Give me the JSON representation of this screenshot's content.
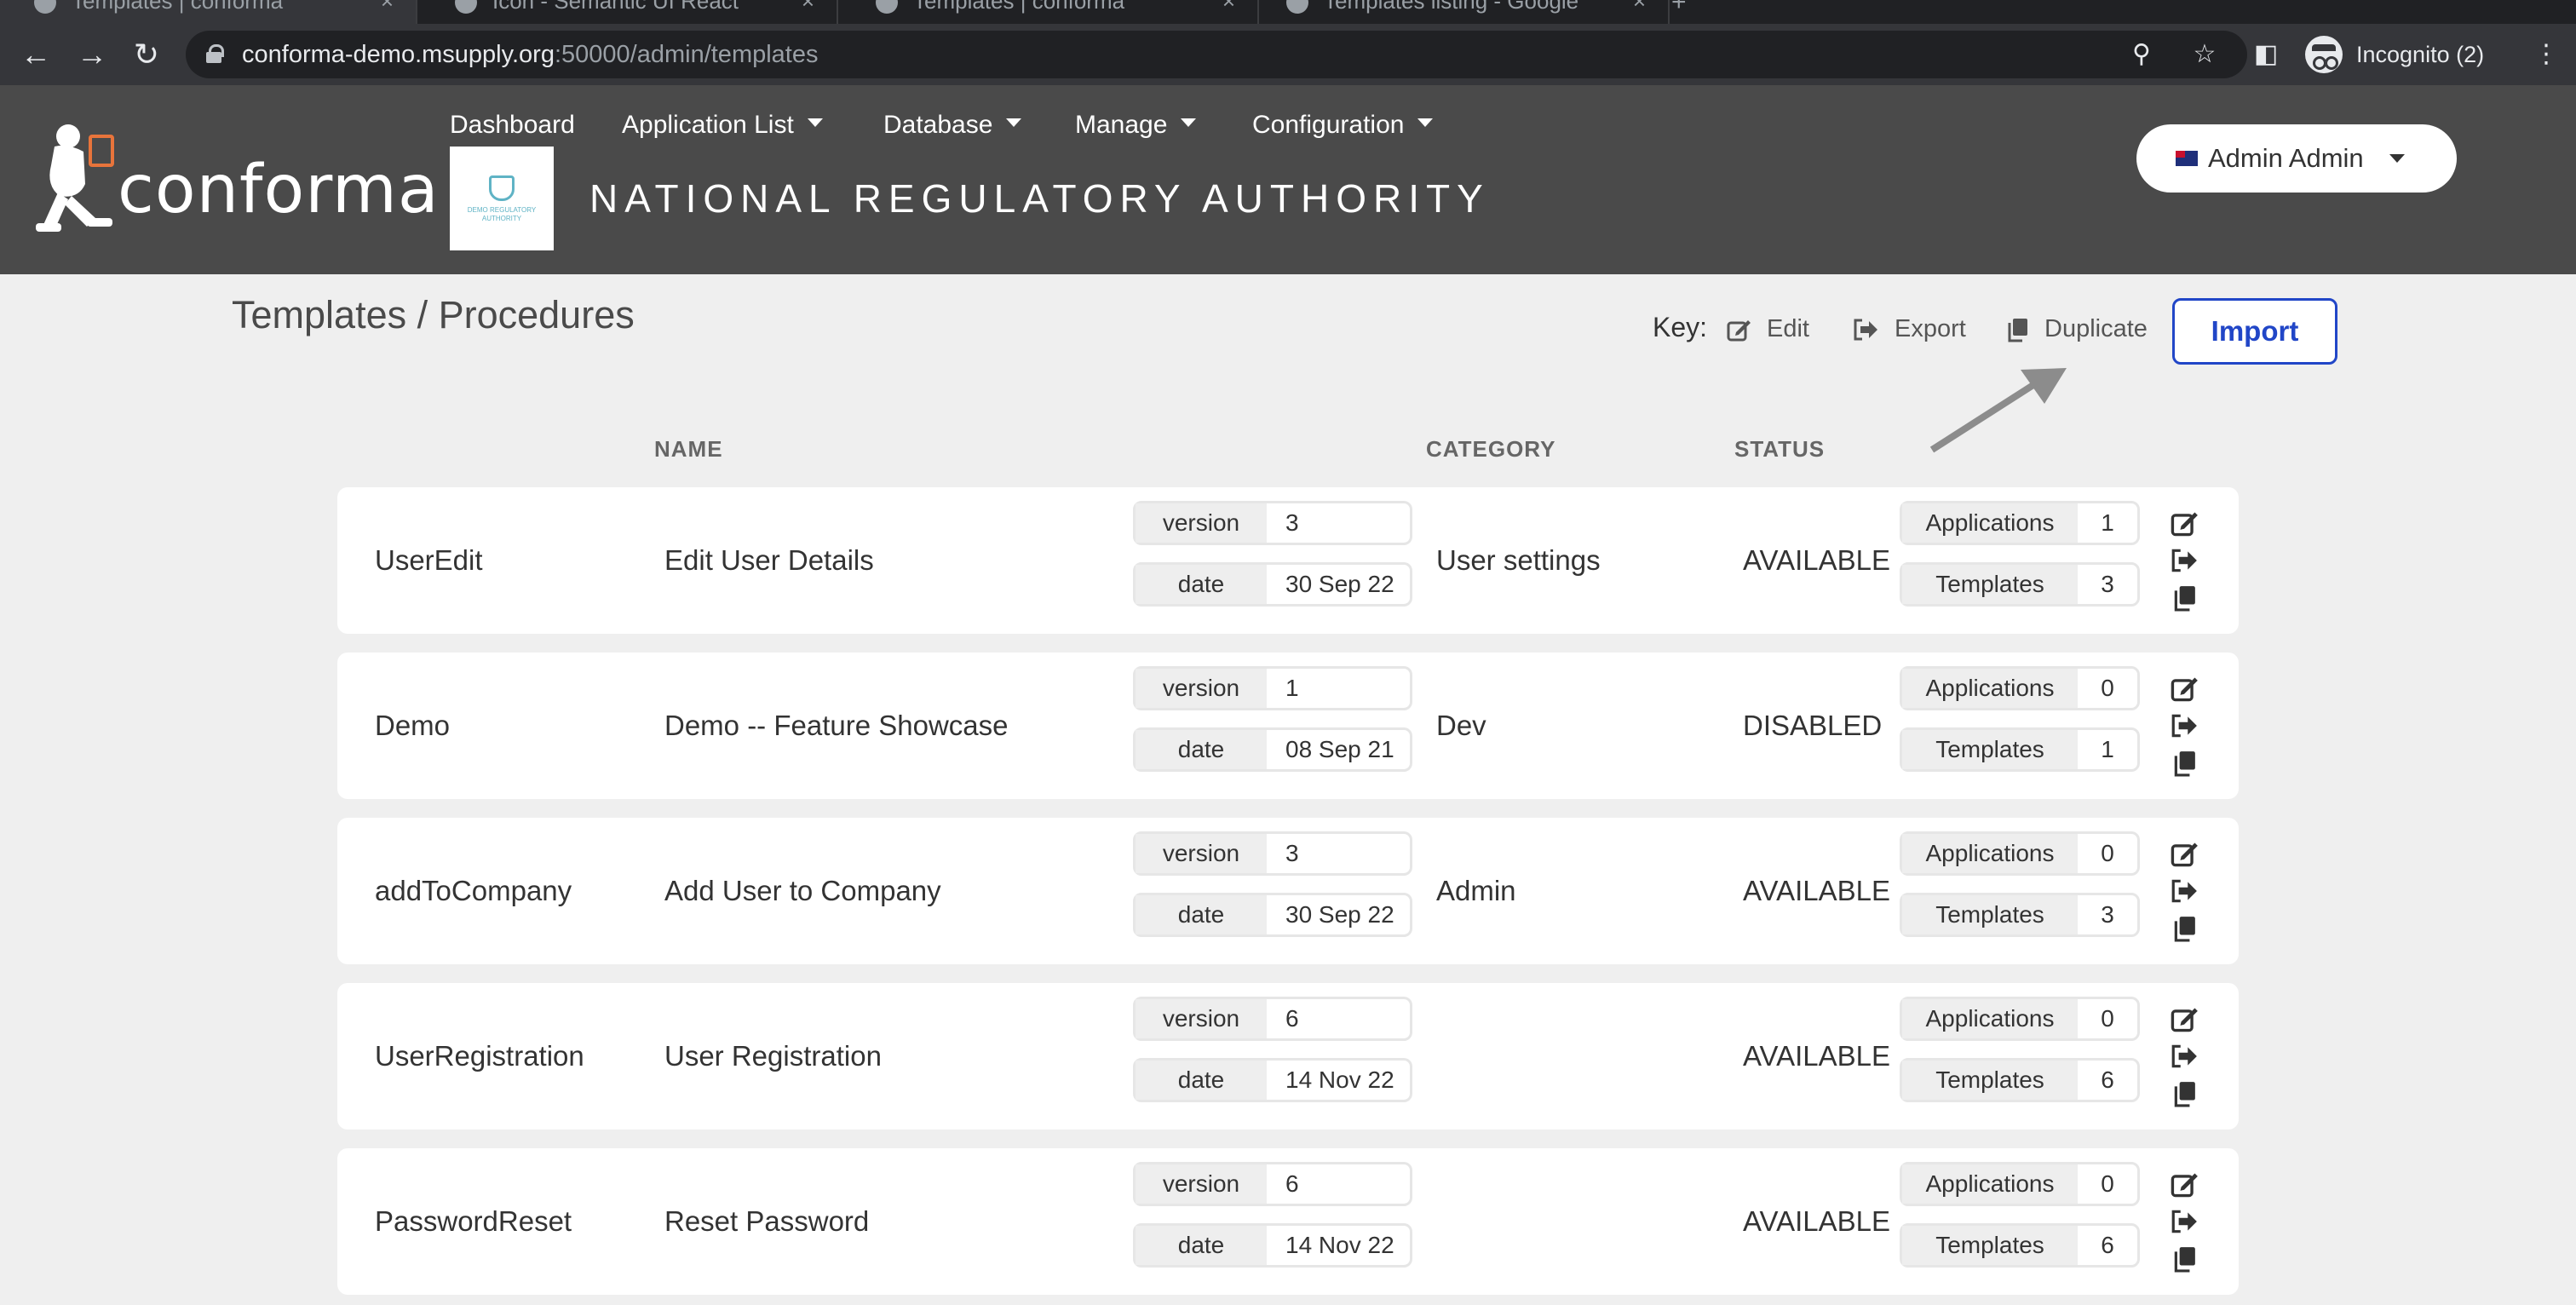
{
  "browser": {
    "tabs": [
      {
        "title": "Templates | conforma"
      },
      {
        "title": "Icon - Semantic UI React"
      },
      {
        "title": "Templates | conforma"
      },
      {
        "title": "Templates listing - Google"
      }
    ],
    "url_host": "conforma-demo.msupply.org",
    "url_path": ":50000/admin/templates",
    "profile_label": "Incognito (2)"
  },
  "app": {
    "logo_text": "conforma",
    "org_logo_text": "DEMO REGULATORY AUTHORITY",
    "org_name": "NATIONAL REGULATORY AUTHORITY",
    "nav": [
      "Dashboard",
      "Application List",
      "Database",
      "Manage",
      "Configuration"
    ],
    "user_label": "Admin Admin"
  },
  "page": {
    "title": "Templates / Procedures",
    "key_label": "Key:",
    "key_edit": "Edit",
    "key_export": "Export",
    "key_duplicate": "Duplicate",
    "import_label": "Import",
    "columns": {
      "name": "NAME",
      "category": "CATEGORY",
      "status": "STATUS"
    },
    "labels": {
      "version": "version",
      "date": "date",
      "applications": "Applications",
      "templates": "Templates"
    },
    "rows": [
      {
        "code": "UserEdit",
        "name": "Edit User Details",
        "version": "3",
        "date": "30 Sep 22",
        "category": "User settings",
        "status": "AVAILABLE",
        "applications": "1",
        "templates": "3"
      },
      {
        "code": "Demo",
        "name": "Demo -- Feature Showcase",
        "version": "1",
        "date": "08 Sep 21",
        "category": "Dev",
        "status": "DISABLED",
        "applications": "0",
        "templates": "1"
      },
      {
        "code": "addToCompany",
        "name": "Add User to Company",
        "version": "3",
        "date": "30 Sep 22",
        "category": "Admin",
        "status": "AVAILABLE",
        "applications": "0",
        "templates": "3"
      },
      {
        "code": "UserRegistration",
        "name": "User Registration",
        "version": "6",
        "date": "14 Nov 22",
        "category": "",
        "status": "AVAILABLE",
        "applications": "0",
        "templates": "6"
      },
      {
        "code": "PasswordReset",
        "name": "Reset Password",
        "version": "6",
        "date": "14 Nov 22",
        "category": "",
        "status": "AVAILABLE",
        "applications": "0",
        "templates": "6"
      }
    ]
  },
  "colors": {
    "header_bg": "#4a4a4a",
    "accent_blue": "#2146c7",
    "page_bg": "#efefef",
    "logo_accent": "#e8743b"
  }
}
